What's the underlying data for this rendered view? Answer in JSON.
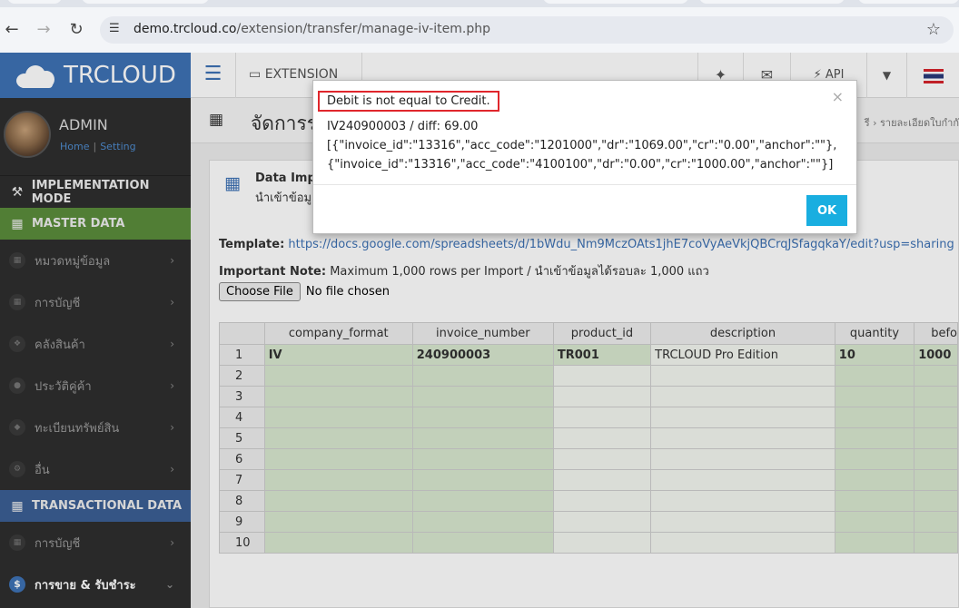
{
  "browser": {
    "url_host": "demo.trcloud.co",
    "url_path": "/extension/transfer/manage-iv-item.php"
  },
  "sidebar": {
    "logo": "TRCLOUD",
    "user_name": "ADMIN",
    "link_home": "Home",
    "link_separator": "|",
    "link_setting": "Setting",
    "sections": [
      {
        "label": "IMPLEMENTATION MODE",
        "icon": "wrench-icon"
      },
      {
        "label": "MASTER DATA",
        "icon": "grid-icon"
      }
    ],
    "master_items": [
      {
        "label": "หมวดหมู่ข้อมูล",
        "icon": "table-icon"
      },
      {
        "label": "การบัญชี",
        "icon": "book-icon"
      },
      {
        "label": "คลังสินค้า",
        "icon": "cubes-icon"
      },
      {
        "label": "ประวัติคู่ค้า",
        "icon": "user-icon"
      },
      {
        "label": "ทะเบียนทรัพย์สิน",
        "icon": "diamond-icon"
      },
      {
        "label": "อื่น",
        "icon": "gear-icon"
      }
    ],
    "transactional_label": "TRANSACTIONAL DATA",
    "trans_items": [
      {
        "label": "การบัญชี",
        "icon": "book-icon"
      },
      {
        "label": "การขาย & รับชำระ",
        "icon": "dollar-icon"
      }
    ]
  },
  "topbar": {
    "extension_label": "EXTENSION",
    "api_label": "API"
  },
  "page": {
    "title": "จัดการร",
    "breadcrumb": "รี  ›  รายละเอียดใบกำกั"
  },
  "panel": {
    "title": "Data Impo",
    "subtitle": "นำเข้าข้อมู",
    "template_label": "Template:",
    "template_url": "https://docs.google.com/spreadsheets/d/1bWdu_Nm9MczOAts1jhE7coVyAeVkjQBCrqJSfagqkaY/edit?usp=sharing",
    "note_label": "Important Note:",
    "note_text": "Maximum 1,000 rows per Import / นำเข้าข้อมูลได้รอบละ 1,000 แถว",
    "file_button": "Choose File",
    "file_status": "No file chosen"
  },
  "sheet": {
    "columns": [
      "company_format",
      "invoice_number",
      "product_id",
      "description",
      "quantity",
      "befo"
    ],
    "rows": [
      [
        "1",
        "IV",
        "240900003",
        "TR001",
        "TRCLOUD Pro Edition",
        "10",
        "1000"
      ],
      [
        "2",
        "",
        "",
        "",
        "",
        "",
        ""
      ],
      [
        "3",
        "",
        "",
        "",
        "",
        "",
        ""
      ],
      [
        "4",
        "",
        "",
        "",
        "",
        "",
        ""
      ],
      [
        "5",
        "",
        "",
        "",
        "",
        "",
        ""
      ],
      [
        "6",
        "",
        "",
        "",
        "",
        "",
        ""
      ],
      [
        "7",
        "",
        "",
        "",
        "",
        "",
        ""
      ],
      [
        "8",
        "",
        "",
        "",
        "",
        "",
        ""
      ],
      [
        "9",
        "",
        "",
        "",
        "",
        "",
        ""
      ],
      [
        "10",
        "",
        "",
        "",
        "",
        "",
        ""
      ]
    ]
  },
  "modal": {
    "alert": "Debit is not equal to Credit.",
    "line1": "IV240900003 / diff: 69.00",
    "line2": "[{\"invoice_id\":\"13316\",\"acc_code\":\"1201000\",\"dr\":\"1069.00\",\"cr\":\"0.00\",\"anchor\":\"\"},",
    "line3": "{\"invoice_id\":\"13316\",\"acc_code\":\"4100100\",\"dr\":\"0.00\",\"cr\":\"1000.00\",\"anchor\":\"\"}]",
    "close": "×",
    "ok_label": "OK"
  }
}
